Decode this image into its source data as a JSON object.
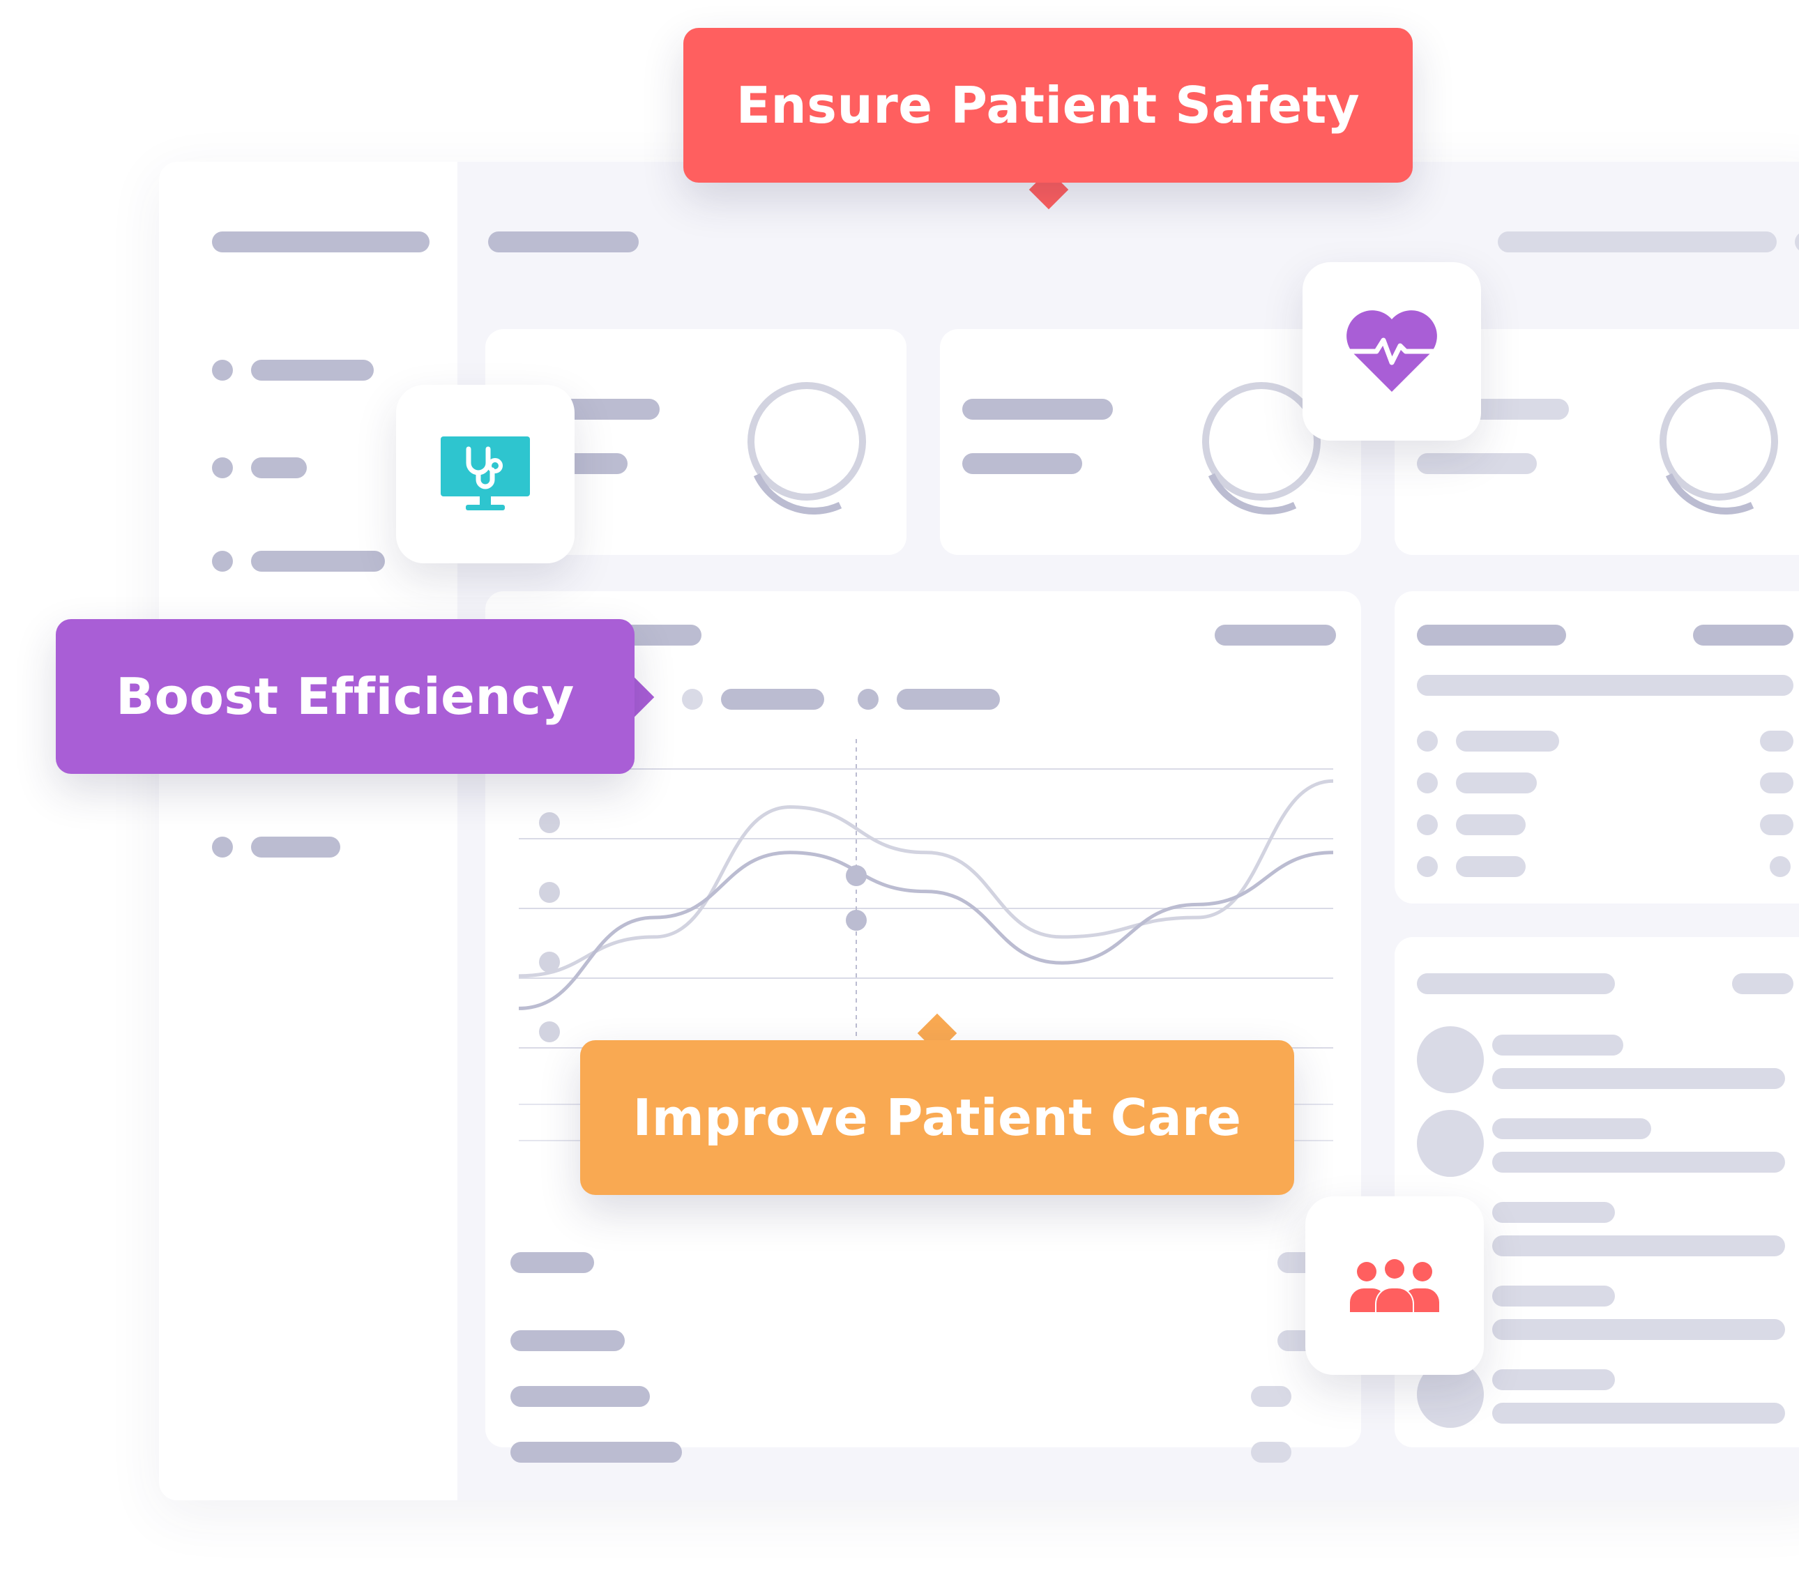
{
  "callouts": {
    "safety": {
      "label": "Ensure Patient Safety",
      "color": "#ff5f5f"
    },
    "efficiency": {
      "label": "Boost Efficiency",
      "color": "#a95ed6"
    },
    "care": {
      "label": "Improve Patient Care",
      "color": "#f9a952"
    }
  },
  "icons": {
    "stethoscope_monitor": {
      "name": "stethoscope-monitor-icon",
      "color": "#2ec5cf"
    },
    "heart_pulse": {
      "name": "heart-pulse-icon",
      "color": "#a95ed6"
    },
    "people_group": {
      "name": "people-group-icon",
      "color": "#ff5f5f"
    }
  },
  "colors": {
    "placeholder": "#bbbcd1",
    "placeholder_light": "#d9dae6",
    "background": "#f5f5fa"
  },
  "chart_data": {
    "type": "line",
    "series": [
      {
        "values": [
          1.0,
          1.6,
          3.6,
          2.9,
          1.6,
          1.9,
          4.0
        ]
      },
      {
        "values": [
          0.5,
          1.9,
          2.9,
          2.3,
          1.2,
          2.1,
          2.9
        ]
      }
    ],
    "grid": true
  }
}
